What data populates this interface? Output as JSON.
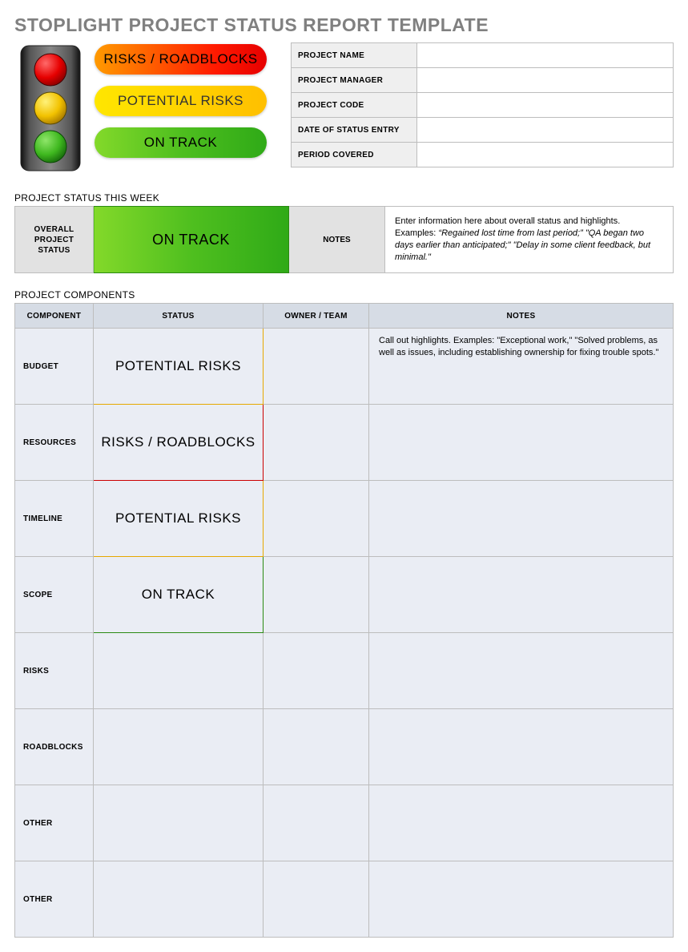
{
  "title": "STOPLIGHT PROJECT STATUS REPORT TEMPLATE",
  "legend": {
    "red": "RISKS / ROADBLOCKS",
    "yellow": "POTENTIAL RISKS",
    "green": "ON TRACK"
  },
  "info_fields": [
    {
      "label": "PROJECT NAME",
      "value": ""
    },
    {
      "label": "PROJECT MANAGER",
      "value": ""
    },
    {
      "label": "PROJECT CODE",
      "value": ""
    },
    {
      "label": "DATE OF STATUS ENTRY",
      "value": ""
    },
    {
      "label": "PERIOD COVERED",
      "value": ""
    }
  ],
  "section_status_week": "PROJECT STATUS THIS WEEK",
  "overall": {
    "header": "OVERALL PROJECT STATUS",
    "status_label": "ON TRACK",
    "status_color": "green",
    "notes_header": "NOTES",
    "notes_intro": "Enter information here about overall status and highlights. Examples: ",
    "notes_examples": "“Regained lost time from last period;” \"QA began two days earlier than anticipated;\" \"Delay in some client feedback, but minimal.\""
  },
  "section_components": "PROJECT COMPONENTS",
  "components_headers": {
    "component": "COMPONENT",
    "status": "STATUS",
    "owner": "OWNER / TEAM",
    "notes": "NOTES"
  },
  "components": [
    {
      "name": "BUDGET",
      "status_label": "POTENTIAL RISKS",
      "status_color": "yellow",
      "owner": "",
      "notes": "Call out highlights. Examples: \"Exceptional work,\" \"Solved problems, as well as issues, including establishing ownership for fixing trouble spots.\""
    },
    {
      "name": "RESOURCES",
      "status_label": "RISKS / ROADBLOCKS",
      "status_color": "red",
      "owner": "",
      "notes": ""
    },
    {
      "name": "TIMELINE",
      "status_label": "POTENTIAL RISKS",
      "status_color": "yellow",
      "owner": "",
      "notes": ""
    },
    {
      "name": "SCOPE",
      "status_label": "ON TRACK",
      "status_color": "green",
      "owner": "",
      "notes": ""
    },
    {
      "name": "RISKS",
      "status_label": "",
      "status_color": "",
      "owner": "",
      "notes": ""
    },
    {
      "name": "ROADBLOCKS",
      "status_label": "",
      "status_color": "",
      "owner": "",
      "notes": ""
    },
    {
      "name": "OTHER",
      "status_label": "",
      "status_color": "",
      "owner": "",
      "notes": ""
    },
    {
      "name": "OTHER",
      "status_label": "",
      "status_color": "",
      "owner": "",
      "notes": ""
    }
  ]
}
